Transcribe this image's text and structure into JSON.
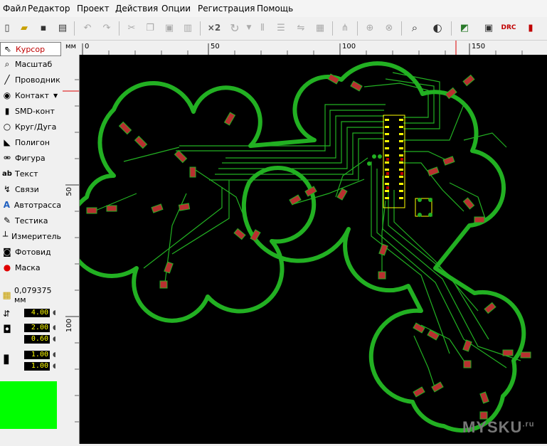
{
  "menu": [
    "Файл",
    "Редактор",
    "Проект",
    "Действия",
    "Опции",
    "Регистрация",
    "Помощь"
  ],
  "toolbar": {
    "zoom_x2_label": "×2",
    "drc_label": "DRC",
    "icons": [
      "new-file",
      "open-folder",
      "save",
      "print",
      "undo",
      "redo",
      "cut",
      "copy",
      "paste",
      "delete",
      "zoom-x2",
      "rotate",
      "align",
      "distribute",
      "group",
      "route",
      "lock",
      "unlock",
      "zoom",
      "toggle-view",
      "autoroute",
      "properties",
      "drc",
      "layer-m"
    ]
  },
  "tools": [
    {
      "label": "Курсор",
      "icon": "cursor-icon",
      "active": true
    },
    {
      "label": "Масштаб",
      "icon": "magnifier-icon"
    },
    {
      "label": "Проводник",
      "icon": "wire-icon"
    },
    {
      "label": "Контакт",
      "icon": "pad-icon"
    },
    {
      "label": "SMD-конт",
      "icon": "smd-pad-icon"
    },
    {
      "label": "Круг/Дуга",
      "icon": "circle-icon"
    },
    {
      "label": "Полигон",
      "icon": "polygon-icon"
    },
    {
      "label": "Фигура",
      "icon": "shape-icon"
    },
    {
      "label": "Текст",
      "icon": "text-icon"
    },
    {
      "label": "Связи",
      "icon": "connections-icon"
    },
    {
      "label": "Автотрасса",
      "icon": "autoroute-icon"
    },
    {
      "label": "Тестика",
      "icon": "tester-icon"
    },
    {
      "label": "Измеритель",
      "icon": "ruler-icon"
    },
    {
      "label": "Фотовид",
      "icon": "camera-icon"
    },
    {
      "label": "Маска",
      "icon": "mask-icon"
    }
  ],
  "grid": {
    "value": "0,079375 мм"
  },
  "params": {
    "track_width": "4.00",
    "pad_outer": "2.00",
    "pad_inner": "0.60",
    "smd_w": "1.00",
    "smd_h": "1.00"
  },
  "ruler": {
    "unit": "мм",
    "top_ticks": [
      "0",
      "50",
      "100",
      "150"
    ],
    "left_ticks": [
      "50",
      "100"
    ]
  },
  "colors": {
    "copper": "#22b022",
    "background": "#000000",
    "component": "#ffff00",
    "swatch": "#00ff00"
  },
  "watermark": "MYSKU",
  "watermark_suffix": ".ru"
}
